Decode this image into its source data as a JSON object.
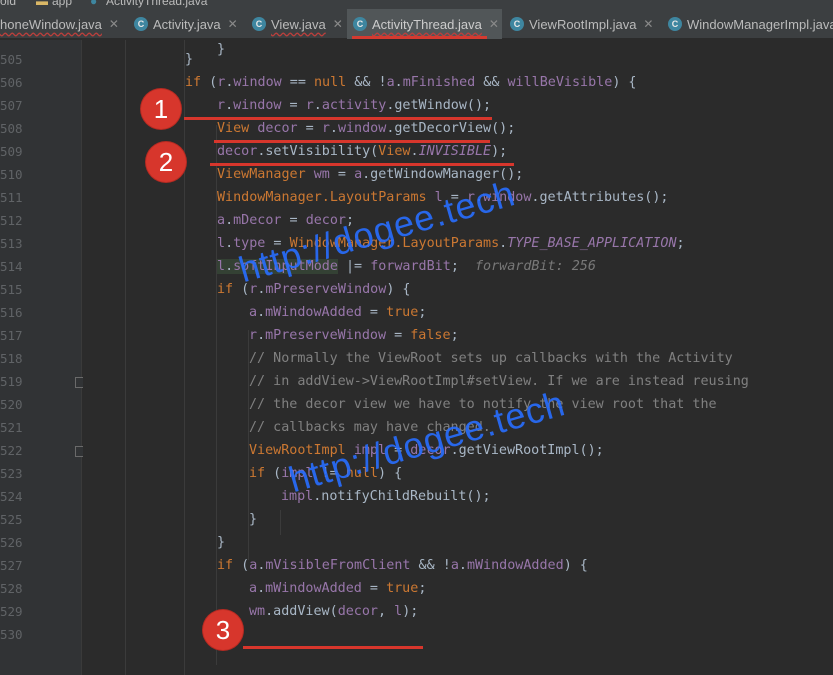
{
  "breadcrumb": {
    "items": [
      "old",
      "app",
      "ActivityThread.java"
    ]
  },
  "tabs": [
    {
      "label": "honeWindow.java",
      "icon": "c-class-icon",
      "active": false
    },
    {
      "label": "Activity.java",
      "icon": "c-class-icon",
      "active": false
    },
    {
      "label": "View.java",
      "icon": "c-class-icon",
      "active": false
    },
    {
      "label": "ActivityThread.java",
      "icon": "c-class-icon",
      "active": true
    },
    {
      "label": "ViewRootImpl.java",
      "icon": "c-class-icon",
      "active": false
    },
    {
      "label": "WindowManagerImpl.java",
      "icon": "c-class-icon",
      "active": false
    }
  ],
  "line_numbers": [
    "505",
    "506",
    "507",
    "508",
    "509",
    "510",
    "511",
    "512",
    "513",
    "514",
    "515",
    "516",
    "517",
    "518",
    "519",
    "520",
    "521",
    "522",
    "523",
    "524",
    "525",
    "526",
    "527",
    "528",
    "529",
    "530"
  ],
  "code": {
    "l504": "}",
    "l505": "}",
    "l506": {
      "kw_if": "if",
      "p1": " (",
      "r1": "r",
      "p2": ".",
      "window": "window",
      "p3": " == ",
      "null": "null",
      "p4": " && !",
      "a1": "a",
      "p5": ".",
      "finished": "mFinished",
      "p6": " && ",
      "vis": "willBeVisible",
      "p7": ") {"
    },
    "l507": {
      "r1": "r",
      "p1": ".",
      "window": "window",
      "p2": " = ",
      "r2": "r",
      "p3": ".",
      "activity": "activity",
      "p4": ".getWindow();"
    },
    "l508": {
      "type": "View",
      "sp": " ",
      "decor": "decor",
      "p1": " = ",
      "r": "r",
      "p2": ".",
      "window": "window",
      "p3": ".getDecorView();"
    },
    "l509": {
      "decor": "decor",
      "p1": ".setVisibility(",
      "view": "View",
      "p2": ".",
      "invisible": "INVISIBLE",
      "p3": ");"
    },
    "l510": {
      "type": "ViewManager",
      "sp": " ",
      "wm": "wm",
      "p1": " = ",
      "a": "a",
      "p2": ".getWindowManager();"
    },
    "l511": {
      "type": "WindowManager.LayoutParams",
      "sp": " ",
      "l": "l",
      "p1": " = ",
      "r": "r",
      "p2": ".",
      "window": "window",
      "p3": ".getAttributes();"
    },
    "l512": {
      "a": "a",
      "p1": ".",
      "mdecor": "mDecor",
      "p2": " = ",
      "decor": "decor",
      "p3": ";"
    },
    "l513": {
      "l": "l",
      "p1": ".",
      "type": "type",
      "p2": " = ",
      "wmlp": "WindowManager.LayoutParams",
      "p3": ".",
      "tba": "TYPE_BASE_APPLICATION",
      "p4": ";"
    },
    "l514": {
      "l": "l",
      "p1": ".",
      "soft": "softInputMode",
      "p2": " |= ",
      "fb": "forwardBit",
      "p3": ";",
      "hint": "forwardBit: 256"
    },
    "l515": {
      "kw_if": "if",
      "p1": " (",
      "r": "r",
      "p2": ".",
      "pw": "mPreserveWindow",
      "p3": ") {"
    },
    "l516": {
      "a": "a",
      "p1": ".",
      "wa": "mWindowAdded",
      "p2": " = ",
      "val": "true",
      "p3": ";"
    },
    "l517": {
      "r": "r",
      "p1": ".",
      "pw": "mPreserveWindow",
      "p2": " = ",
      "val": "false",
      "p3": ";"
    },
    "l518": "// Normally the ViewRoot sets up callbacks with the Activity",
    "l519": "// in addView->ViewRootImpl#setView. If we are instead reusing",
    "l520": "// the decor view we have to notify the view root that the",
    "l521": "// callbacks may have changed.",
    "l522": {
      "type": "ViewRootImpl",
      "sp": " ",
      "impl": "impl",
      "p1": " = ",
      "decor": "decor",
      "p2": ".getViewRootImpl();"
    },
    "l523": {
      "kw_if": "if",
      "p1": " (",
      "impl": "impl",
      "p2": " != ",
      "null": "null",
      "p3": ") {"
    },
    "l524": {
      "impl": "impl",
      "p1": ".notifyChildRebuilt();"
    },
    "l525": "}",
    "l526": "}",
    "l527": {
      "kw_if": "if",
      "p1": " (",
      "a1": "a",
      "p2": ".",
      "vfc": "mVisibleFromClient",
      "p3": " && !",
      "a2": "a",
      "p4": ".",
      "wa": "mWindowAdded",
      "p5": ") {"
    },
    "l528": {
      "a": "a",
      "p1": ".",
      "wa": "mWindowAdded",
      "p2": " = ",
      "val": "true",
      "p3": ";"
    },
    "l529": {
      "wm": "wm",
      "p1": ".addView(",
      "decor": "decor",
      "p2": ", ",
      "l": "l",
      "p3": ");"
    },
    "l530": "}"
  },
  "annotations": {
    "badge1": "1",
    "badge2": "2",
    "badge3": "3"
  },
  "watermark": {
    "text1": "http://dogee.tech",
    "text2": "http://dogee.tech"
  },
  "colors": {
    "accent_red": "#d7362c",
    "watermark_blue": "#286eff",
    "editor_bg": "#2b2b2b",
    "keyword": "#cc7832",
    "field": "#9876aa"
  }
}
